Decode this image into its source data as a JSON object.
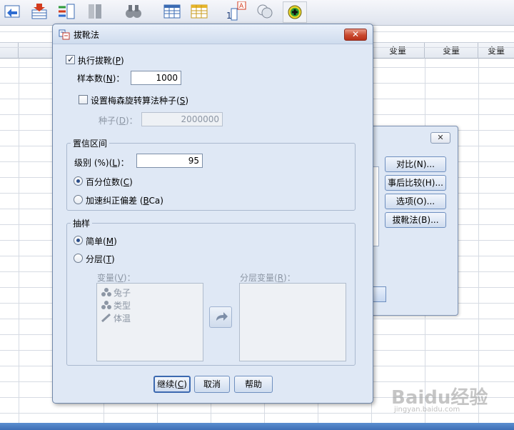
{
  "background": {
    "column_header": "变量",
    "dialog2_buttons": [
      "对比(N)...",
      "事后比较(H)...",
      "选项(O)...",
      "拔靴法(B)..."
    ]
  },
  "dialog": {
    "title": "拔靴法",
    "close_label": "✕",
    "perform_bootstrap": {
      "label": "执行拔靴",
      "key": "P",
      "checked": true
    },
    "num_samples": {
      "label": "样本数",
      "key": "N",
      "value": "1000"
    },
    "set_seed": {
      "label": "设置梅森旋转算法种子",
      "key": "S",
      "checked": false
    },
    "seed": {
      "label": "种子",
      "key": "D",
      "value": "2000000"
    },
    "confidence": {
      "legend": "置信区间",
      "level_label": "级别 (%)",
      "level_key": "L",
      "level_value": "95",
      "percentile": {
        "label": "百分位数",
        "key": "C",
        "selected": true
      },
      "bca": {
        "label": "加速纠正偏差 (",
        "key": "B",
        "label_tail": "Ca)",
        "selected": false
      }
    },
    "sampling": {
      "legend": "抽样",
      "simple": {
        "label": "简单",
        "key": "M",
        "selected": true
      },
      "stratified": {
        "label": "分层",
        "key": "T",
        "selected": false
      },
      "variables_label": "变量",
      "variables_key": "V",
      "strata_label": "分层变量",
      "strata_key": "R",
      "variables": [
        {
          "name": "兔子",
          "icon": "nominal-icon"
        },
        {
          "name": "类型",
          "icon": "nominal-icon"
        },
        {
          "name": "体温",
          "icon": "scale-icon"
        }
      ]
    },
    "buttons": {
      "continue": {
        "label": "继续",
        "key": "C"
      },
      "cancel": "取消",
      "help": "帮助"
    }
  },
  "watermark": {
    "main": "Baidu经验",
    "sub": "jingyan.baidu.com"
  }
}
